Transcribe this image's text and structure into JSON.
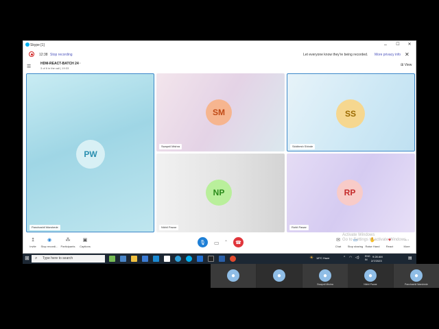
{
  "window": {
    "title": "Skype [1]",
    "minimize": "–",
    "maximize": "☐",
    "close": "✕"
  },
  "recording": {
    "time": "12:38",
    "stop_label": "Stop recording",
    "message": "Let everyone know they're being recorded.",
    "privacy_link": "More privacy info",
    "close": "✕"
  },
  "call": {
    "name": "HDM-REACT-BATCH 24 ·",
    "status": "3 of 6 in the call | 19:33",
    "view_label": "View"
  },
  "participants": [
    {
      "initials": "PW",
      "name": "Panchashil Warshede",
      "bg": "#a8dbe8",
      "av_bg": "#d8f0f5",
      "av_fg": "#2a8fb0",
      "selected": true
    },
    {
      "initials": "SM",
      "name": "Swapnil Mishra",
      "bg": "#ead9e2",
      "av_bg": "#f6b58f",
      "av_fg": "#c04a16",
      "selected": false
    },
    {
      "initials": "SS",
      "name": "Siddhesh Shinde",
      "bg": "#d4ecf7",
      "av_bg": "#f6d78f",
      "av_fg": "#9a6a00",
      "selected": true
    },
    {
      "initials": "NP",
      "name": "Nikhil Pawar",
      "bg": "#e6e6e6",
      "av_bg": "#b9ef9b",
      "av_fg": "#2a8a1a",
      "selected": false
    },
    {
      "initials": "RP",
      "name": "Rohit Pawar",
      "bg": "#d8cdf0",
      "av_bg": "#f8cbc8",
      "av_fg": "#c42a2a",
      "selected": false
    }
  ],
  "controls": {
    "left": [
      {
        "label": "Invite",
        "icon": "↥"
      },
      {
        "label": "Stop recordi...",
        "icon": "◉"
      },
      {
        "label": "Participants",
        "icon": "⁂"
      },
      {
        "label": "Captions",
        "icon": "▣"
      }
    ],
    "right": [
      {
        "label": "Chat",
        "icon": "✉"
      },
      {
        "label": "Stop sharing",
        "icon": "▭"
      },
      {
        "label": "Raise Hand",
        "icon": "✋"
      },
      {
        "label": "React",
        "icon": "♥"
      },
      {
        "label": "More",
        "icon": "···"
      }
    ],
    "mic_icon": "🎙",
    "video_icon": "▭",
    "hangup_icon": "☎"
  },
  "watermark": "Activate Windows\nGo to Settings to activate Windows.",
  "taskbar": {
    "search_placeholder": "Type here to search",
    "weather": "18°C  Haze",
    "lang": "ENG\nIN",
    "time": "9:28 AM",
    "date": "2/7/2023"
  },
  "strip": [
    {
      "name": ""
    },
    {
      "name": ""
    },
    {
      "name": "Swapnil Mishra"
    },
    {
      "name": "Nikhil Pawar"
    },
    {
      "name": "Panchashil Warshede"
    }
  ],
  "colors": {
    "accent": "#4b53bc",
    "record_red": "#d02020",
    "mic_blue": "#1e7fd6",
    "hangup_red": "#e0353b"
  }
}
